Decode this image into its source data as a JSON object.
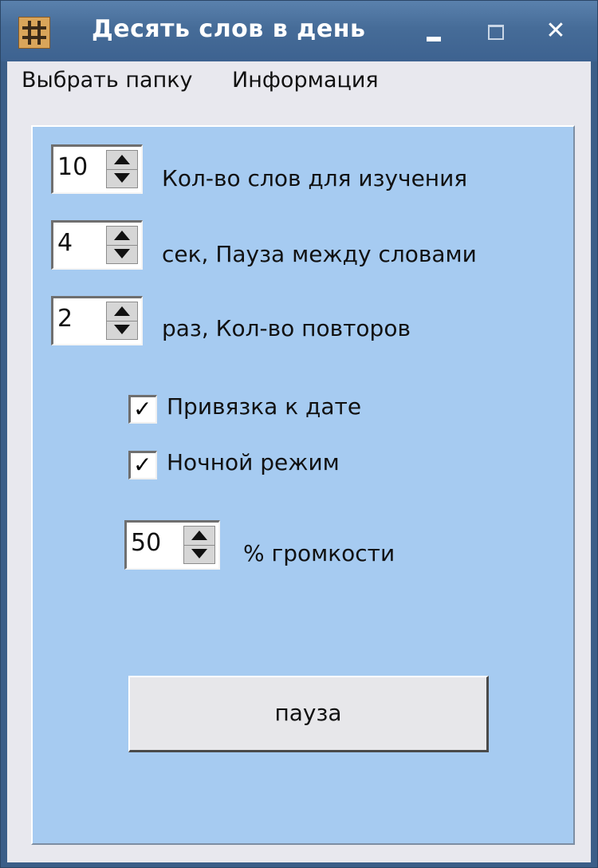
{
  "window": {
    "title": "Десять слов в день",
    "controls": {
      "minimize": "minimize",
      "maximize": "maximize",
      "close": "✕"
    },
    "icon": "app-icon"
  },
  "menubar": {
    "items": [
      {
        "label": "Выбрать папку"
      },
      {
        "label": "Информация"
      }
    ]
  },
  "settings": {
    "word_count": {
      "value": "10",
      "label": "Кол-во слов для изучения"
    },
    "pause_seconds": {
      "value": "4",
      "label": "сек, Пауза между словами"
    },
    "repeat_count": {
      "value": "2",
      "label": "раз, Кол-во повторов"
    },
    "bind_to_date": {
      "checked": true,
      "label": "Привязка к дате"
    },
    "night_mode": {
      "checked": true,
      "label": "Ночной режим"
    },
    "volume": {
      "value": "50",
      "label": "% громкости"
    }
  },
  "actions": {
    "pause_label": "пауза"
  },
  "colors": {
    "titlebar": "#466c98",
    "panel": "#a6cbf1",
    "client": "#e8e8ee"
  },
  "checkmark_glyph": "✓"
}
